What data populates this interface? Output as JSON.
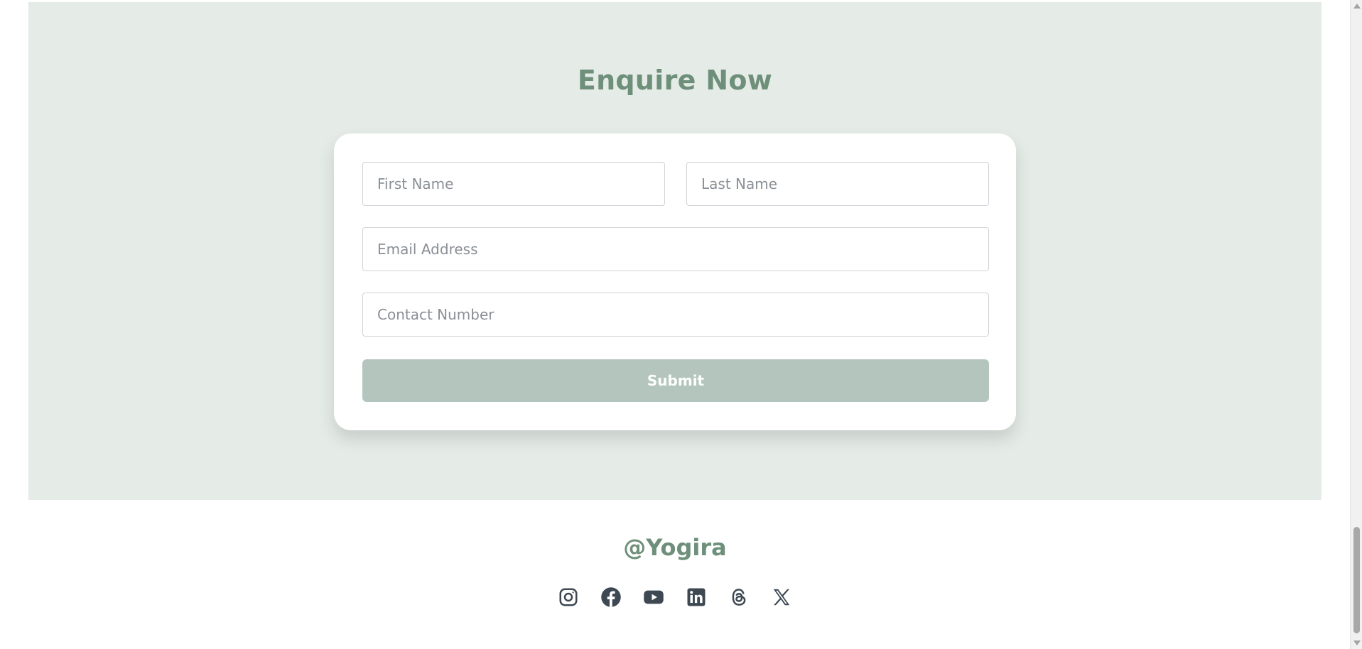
{
  "enquire": {
    "title": "Enquire Now",
    "first_name_placeholder": "First Name",
    "last_name_placeholder": "Last Name",
    "email_placeholder": "Email Address",
    "contact_placeholder": "Contact Number",
    "submit_label": "Submit"
  },
  "footer": {
    "handle": "@Yogira",
    "social_icons": [
      "instagram-icon",
      "facebook-icon",
      "youtube-icon",
      "linkedin-icon",
      "threads-icon",
      "x-icon"
    ]
  },
  "colors": {
    "section_bg": "#e5ebe7",
    "accent_green": "#6e8f79",
    "submit_bg": "#b3c5bd",
    "icon_color": "#3d4852"
  }
}
